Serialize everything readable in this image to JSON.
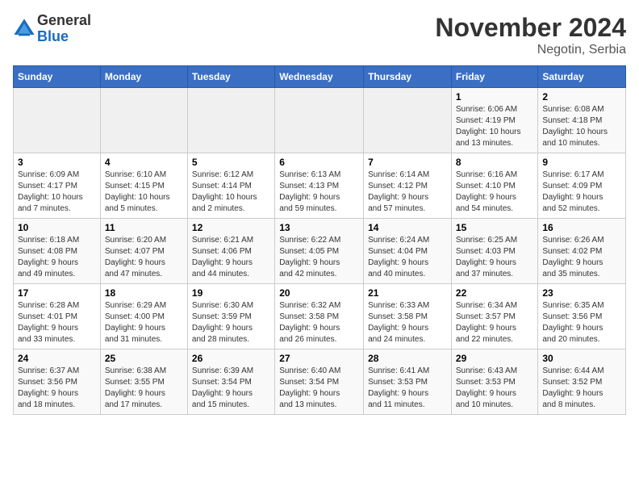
{
  "header": {
    "logo_general": "General",
    "logo_blue": "Blue",
    "month_title": "November 2024",
    "location": "Negotin, Serbia"
  },
  "calendar": {
    "days_of_week": [
      "Sunday",
      "Monday",
      "Tuesday",
      "Wednesday",
      "Thursday",
      "Friday",
      "Saturday"
    ],
    "weeks": [
      [
        {
          "day": "",
          "info": "",
          "empty": true
        },
        {
          "day": "",
          "info": "",
          "empty": true
        },
        {
          "day": "",
          "info": "",
          "empty": true
        },
        {
          "day": "",
          "info": "",
          "empty": true
        },
        {
          "day": "",
          "info": "",
          "empty": true
        },
        {
          "day": "1",
          "info": "Sunrise: 6:06 AM\nSunset: 4:19 PM\nDaylight: 10 hours\nand 13 minutes.",
          "empty": false
        },
        {
          "day": "2",
          "info": "Sunrise: 6:08 AM\nSunset: 4:18 PM\nDaylight: 10 hours\nand 10 minutes.",
          "empty": false
        }
      ],
      [
        {
          "day": "3",
          "info": "Sunrise: 6:09 AM\nSunset: 4:17 PM\nDaylight: 10 hours\nand 7 minutes.",
          "empty": false
        },
        {
          "day": "4",
          "info": "Sunrise: 6:10 AM\nSunset: 4:15 PM\nDaylight: 10 hours\nand 5 minutes.",
          "empty": false
        },
        {
          "day": "5",
          "info": "Sunrise: 6:12 AM\nSunset: 4:14 PM\nDaylight: 10 hours\nand 2 minutes.",
          "empty": false
        },
        {
          "day": "6",
          "info": "Sunrise: 6:13 AM\nSunset: 4:13 PM\nDaylight: 9 hours\nand 59 minutes.",
          "empty": false
        },
        {
          "day": "7",
          "info": "Sunrise: 6:14 AM\nSunset: 4:12 PM\nDaylight: 9 hours\nand 57 minutes.",
          "empty": false
        },
        {
          "day": "8",
          "info": "Sunrise: 6:16 AM\nSunset: 4:10 PM\nDaylight: 9 hours\nand 54 minutes.",
          "empty": false
        },
        {
          "day": "9",
          "info": "Sunrise: 6:17 AM\nSunset: 4:09 PM\nDaylight: 9 hours\nand 52 minutes.",
          "empty": false
        }
      ],
      [
        {
          "day": "10",
          "info": "Sunrise: 6:18 AM\nSunset: 4:08 PM\nDaylight: 9 hours\nand 49 minutes.",
          "empty": false
        },
        {
          "day": "11",
          "info": "Sunrise: 6:20 AM\nSunset: 4:07 PM\nDaylight: 9 hours\nand 47 minutes.",
          "empty": false
        },
        {
          "day": "12",
          "info": "Sunrise: 6:21 AM\nSunset: 4:06 PM\nDaylight: 9 hours\nand 44 minutes.",
          "empty": false
        },
        {
          "day": "13",
          "info": "Sunrise: 6:22 AM\nSunset: 4:05 PM\nDaylight: 9 hours\nand 42 minutes.",
          "empty": false
        },
        {
          "day": "14",
          "info": "Sunrise: 6:24 AM\nSunset: 4:04 PM\nDaylight: 9 hours\nand 40 minutes.",
          "empty": false
        },
        {
          "day": "15",
          "info": "Sunrise: 6:25 AM\nSunset: 4:03 PM\nDaylight: 9 hours\nand 37 minutes.",
          "empty": false
        },
        {
          "day": "16",
          "info": "Sunrise: 6:26 AM\nSunset: 4:02 PM\nDaylight: 9 hours\nand 35 minutes.",
          "empty": false
        }
      ],
      [
        {
          "day": "17",
          "info": "Sunrise: 6:28 AM\nSunset: 4:01 PM\nDaylight: 9 hours\nand 33 minutes.",
          "empty": false
        },
        {
          "day": "18",
          "info": "Sunrise: 6:29 AM\nSunset: 4:00 PM\nDaylight: 9 hours\nand 31 minutes.",
          "empty": false
        },
        {
          "day": "19",
          "info": "Sunrise: 6:30 AM\nSunset: 3:59 PM\nDaylight: 9 hours\nand 28 minutes.",
          "empty": false
        },
        {
          "day": "20",
          "info": "Sunrise: 6:32 AM\nSunset: 3:58 PM\nDaylight: 9 hours\nand 26 minutes.",
          "empty": false
        },
        {
          "day": "21",
          "info": "Sunrise: 6:33 AM\nSunset: 3:58 PM\nDaylight: 9 hours\nand 24 minutes.",
          "empty": false
        },
        {
          "day": "22",
          "info": "Sunrise: 6:34 AM\nSunset: 3:57 PM\nDaylight: 9 hours\nand 22 minutes.",
          "empty": false
        },
        {
          "day": "23",
          "info": "Sunrise: 6:35 AM\nSunset: 3:56 PM\nDaylight: 9 hours\nand 20 minutes.",
          "empty": false
        }
      ],
      [
        {
          "day": "24",
          "info": "Sunrise: 6:37 AM\nSunset: 3:56 PM\nDaylight: 9 hours\nand 18 minutes.",
          "empty": false
        },
        {
          "day": "25",
          "info": "Sunrise: 6:38 AM\nSunset: 3:55 PM\nDaylight: 9 hours\nand 17 minutes.",
          "empty": false
        },
        {
          "day": "26",
          "info": "Sunrise: 6:39 AM\nSunset: 3:54 PM\nDaylight: 9 hours\nand 15 minutes.",
          "empty": false
        },
        {
          "day": "27",
          "info": "Sunrise: 6:40 AM\nSunset: 3:54 PM\nDaylight: 9 hours\nand 13 minutes.",
          "empty": false
        },
        {
          "day": "28",
          "info": "Sunrise: 6:41 AM\nSunset: 3:53 PM\nDaylight: 9 hours\nand 11 minutes.",
          "empty": false
        },
        {
          "day": "29",
          "info": "Sunrise: 6:43 AM\nSunset: 3:53 PM\nDaylight: 9 hours\nand 10 minutes.",
          "empty": false
        },
        {
          "day": "30",
          "info": "Sunrise: 6:44 AM\nSunset: 3:52 PM\nDaylight: 9 hours\nand 8 minutes.",
          "empty": false
        }
      ]
    ]
  }
}
